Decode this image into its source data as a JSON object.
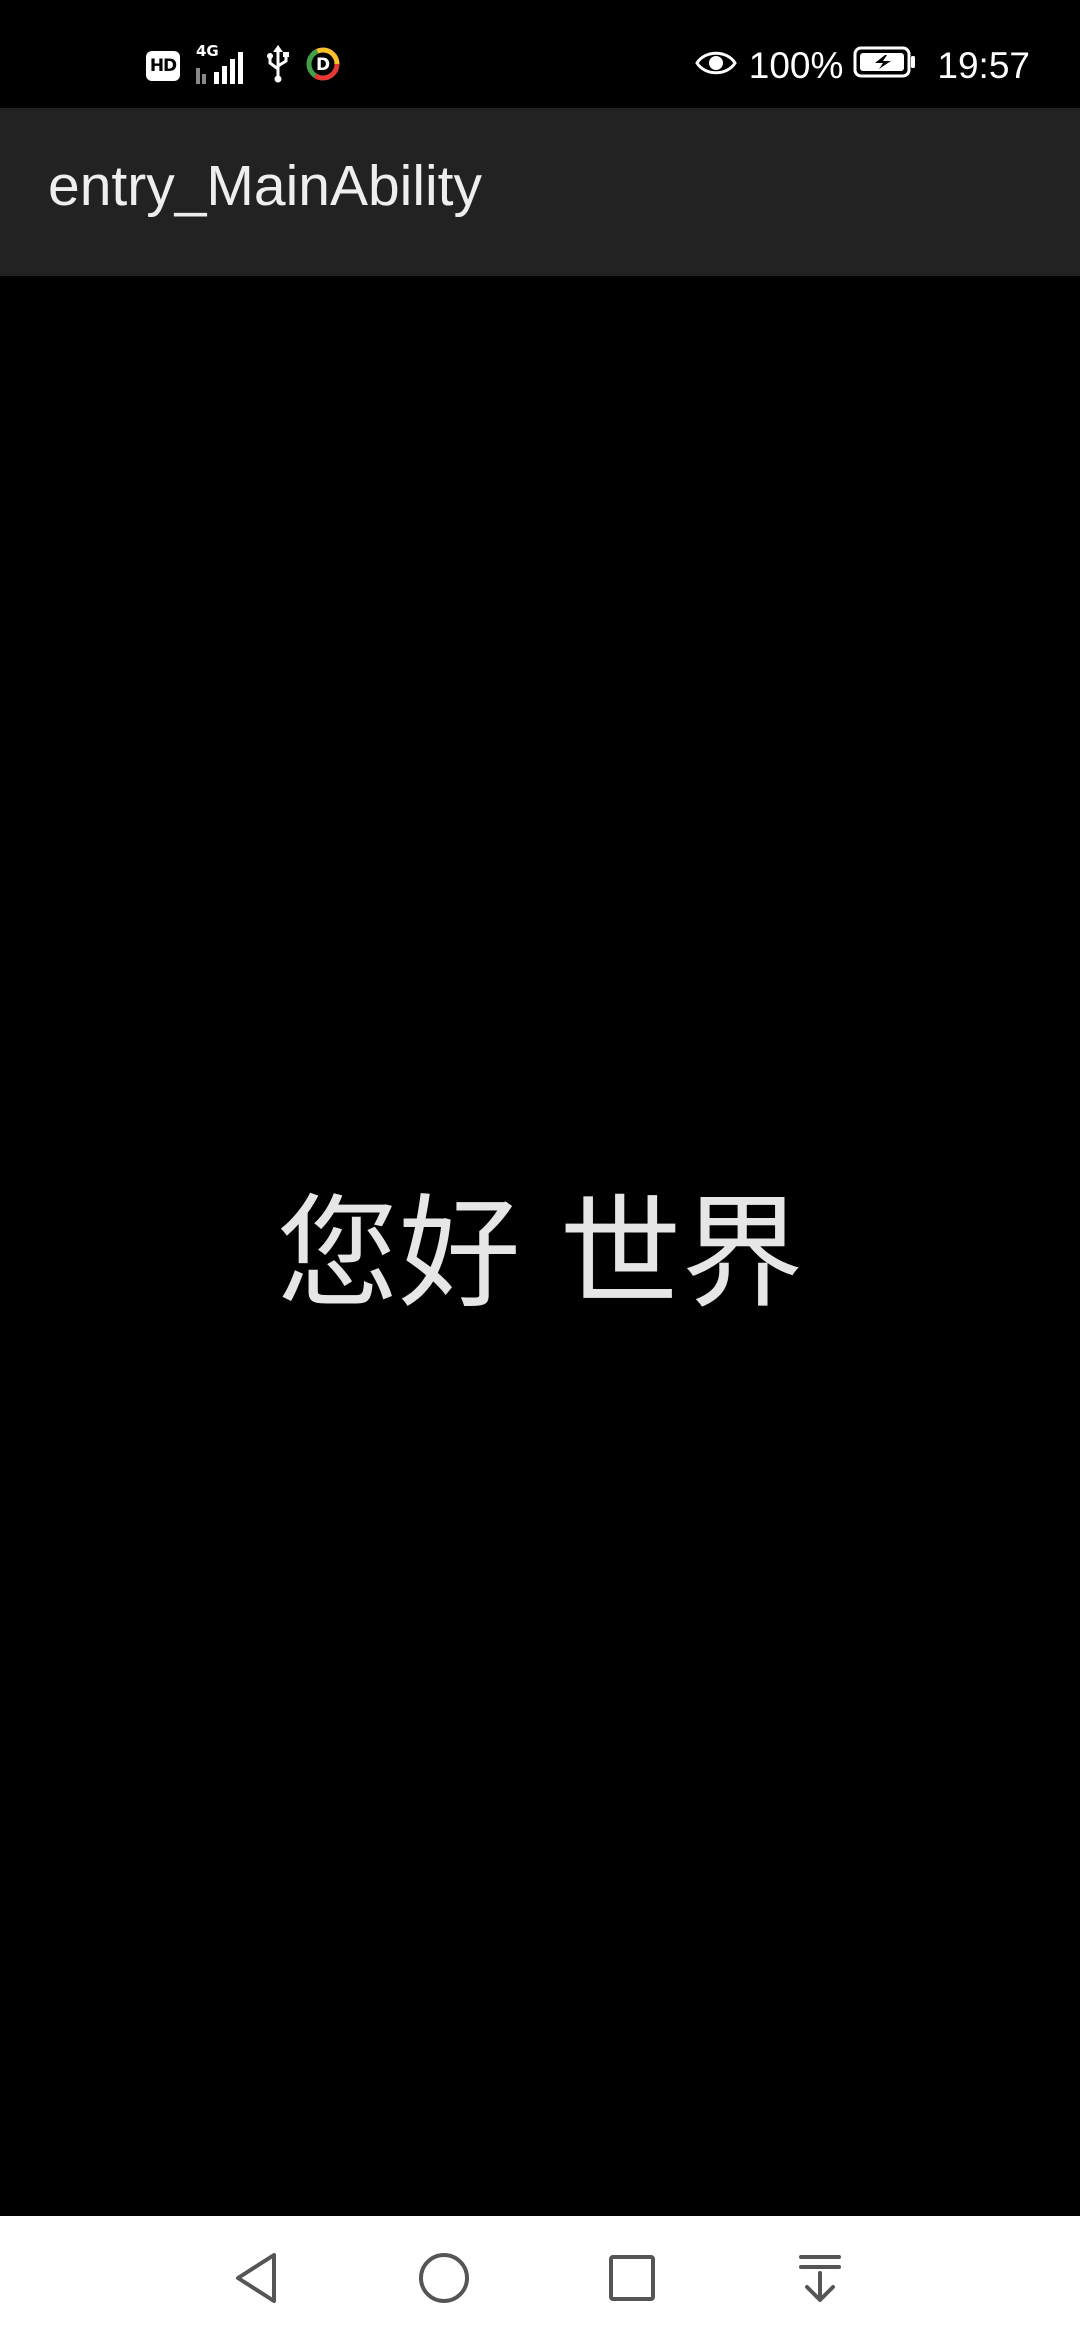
{
  "status_bar": {
    "hd_label": "HD",
    "network_type": "4G",
    "battery_percent": "100%",
    "time": "19:57",
    "icons": [
      "hd-icon",
      "signal-icon",
      "usb-icon",
      "app-notification-icon",
      "eye-comfort-icon",
      "battery-charging-icon"
    ]
  },
  "title_bar": {
    "title": "entry_MainAbility"
  },
  "main": {
    "text": "您好 世界"
  },
  "nav_bar": {
    "buttons": [
      "back-icon",
      "home-icon",
      "recents-icon",
      "notification-pulldown-icon"
    ]
  },
  "colors": {
    "background": "#000000",
    "title_bar_bg": "#222222",
    "nav_bar_bg": "#ffffff",
    "text": "#e6e6e6"
  }
}
